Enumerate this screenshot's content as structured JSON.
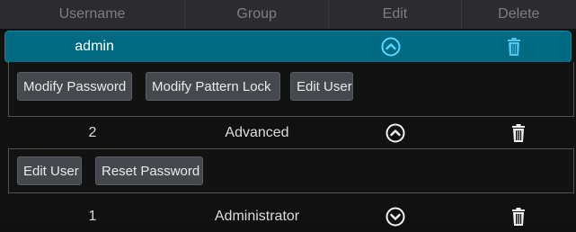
{
  "columns": {
    "username": "Username",
    "group": "Group",
    "edit": "Edit",
    "delete": "Delete"
  },
  "users": [
    {
      "username": "admin",
      "group": "",
      "expanded": true,
      "edit_icon": "chevron-up-circle-icon",
      "delete_icon": "trash-icon",
      "actions": [
        "Modify Password",
        "Modify Pattern Lock",
        "Edit User"
      ]
    },
    {
      "username": "2",
      "group": "Advanced",
      "expanded": true,
      "edit_icon": "chevron-up-circle-icon",
      "delete_icon": "trash-icon",
      "actions": [
        "Edit User",
        "Reset Password"
      ]
    },
    {
      "username": "1",
      "group": "Administrator",
      "expanded": false,
      "edit_icon": "chevron-down-circle-icon",
      "delete_icon": "trash-icon",
      "actions": []
    }
  ],
  "colors": {
    "selected_row": "#006a83",
    "header": "#2c2c2e",
    "button": "#45484d"
  }
}
